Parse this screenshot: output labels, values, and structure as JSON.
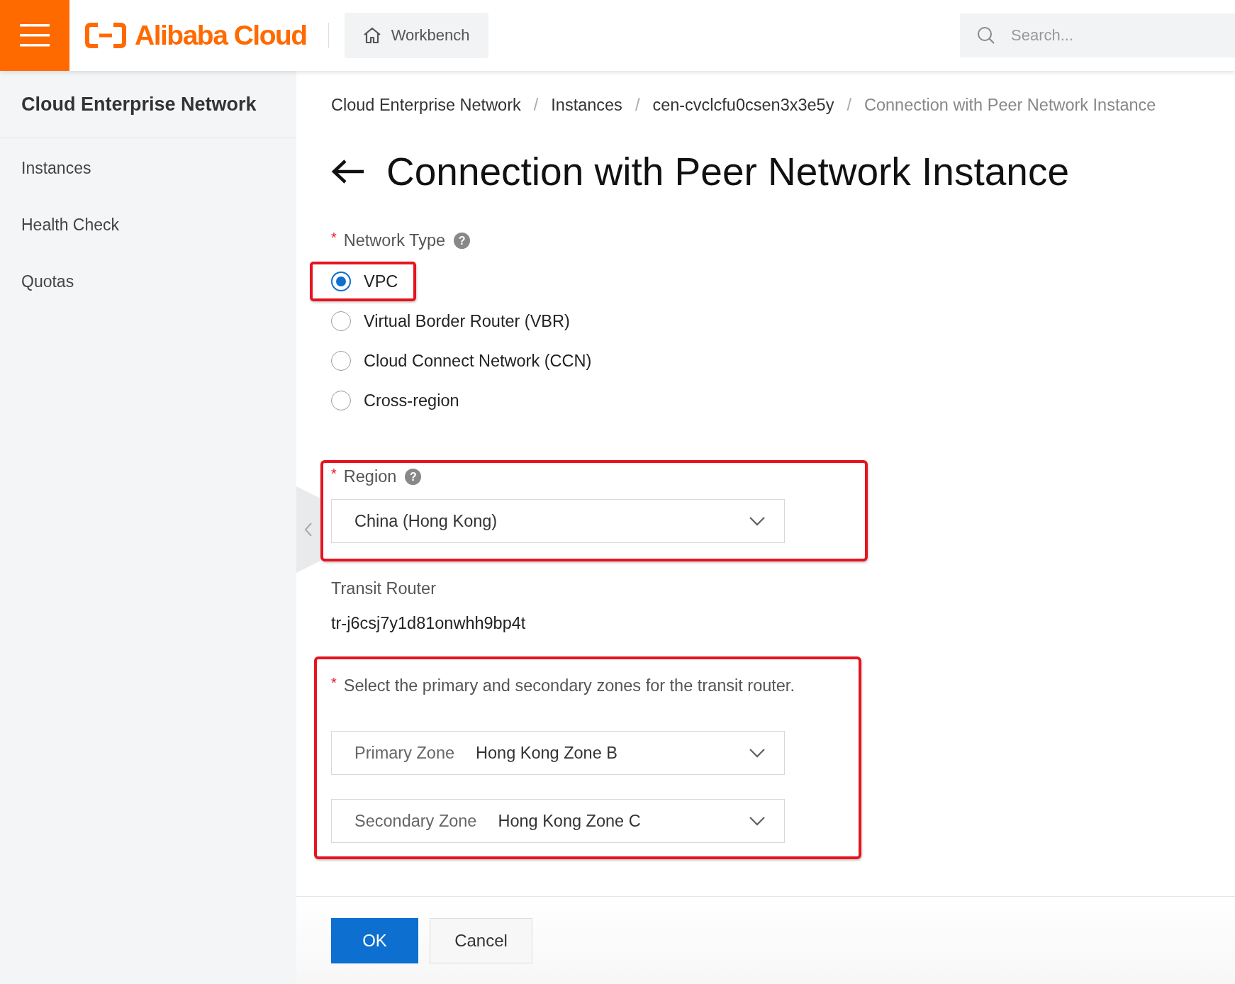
{
  "header": {
    "logo": "Alibaba Cloud",
    "workbench": "Workbench",
    "search": {
      "placeholder": "Search..."
    }
  },
  "sidebar": {
    "title": "Cloud Enterprise Network",
    "items": [
      {
        "label": "Instances"
      },
      {
        "label": "Health Check"
      },
      {
        "label": "Quotas"
      }
    ]
  },
  "breadcrumb": [
    {
      "label": "Cloud Enterprise Network",
      "current": false
    },
    {
      "label": "Instances",
      "current": false
    },
    {
      "label": "cen-cvclcfu0csen3x3e5y",
      "current": false
    },
    {
      "label": "Connection with Peer Network Instance",
      "current": true
    }
  ],
  "breadcrumb_separator": "/",
  "page_title": "Connection with Peer Network Instance",
  "network_type": {
    "required_mark": "*",
    "label": "Network Type",
    "help": "?",
    "options": [
      {
        "label": "VPC",
        "selected": true,
        "highlighted": true
      },
      {
        "label": "Virtual Border Router (VBR)",
        "selected": false,
        "highlighted": false
      },
      {
        "label": "Cloud Connect Network (CCN)",
        "selected": false,
        "highlighted": false
      },
      {
        "label": "Cross-region",
        "selected": false,
        "highlighted": false
      }
    ]
  },
  "region": {
    "required_mark": "*",
    "label": "Region",
    "help": "?",
    "value": "China (Hong Kong)",
    "highlighted": true
  },
  "transit_router": {
    "label": "Transit Router",
    "value": "tr-j6csj7y1d81onwhh9bp4t"
  },
  "zones": {
    "required_mark": "*",
    "label": "Select the primary and secondary zones for the transit router.",
    "highlighted": true,
    "selects": [
      {
        "label": "Primary Zone",
        "value": "Hong Kong Zone B"
      },
      {
        "label": "Secondary Zone",
        "value": "Hong Kong Zone C"
      }
    ]
  },
  "footer": {
    "buttons": [
      {
        "label": "OK",
        "kind": "primary"
      },
      {
        "label": "Cancel",
        "kind": "secondary"
      }
    ]
  }
}
